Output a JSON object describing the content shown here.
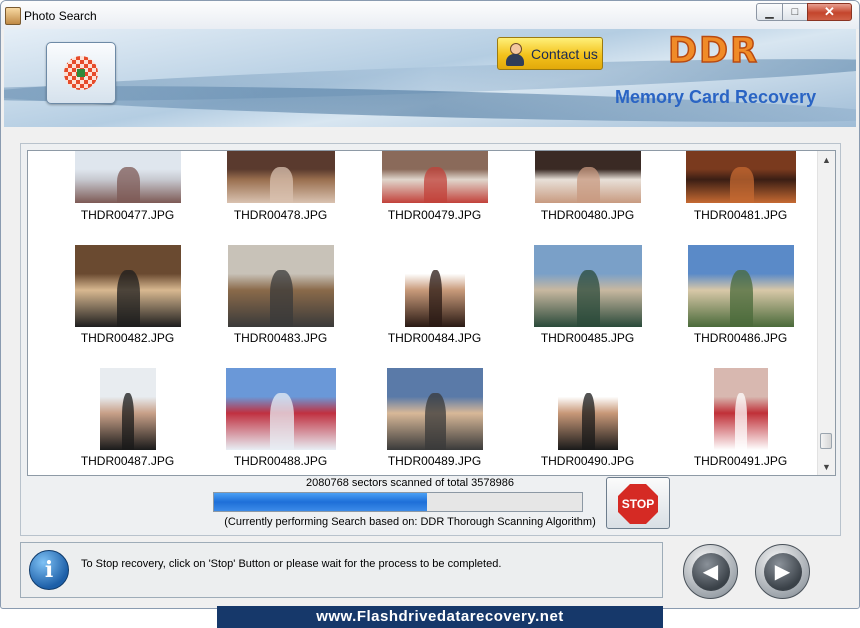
{
  "window": {
    "title": "Photo Search",
    "controls": {
      "minimize": "▁",
      "maximize": "□",
      "close": "✕"
    }
  },
  "header": {
    "contact_label": "Contact us",
    "brand": "DDR",
    "product": "Memory Card Recovery"
  },
  "gallery": {
    "rows": [
      [
        {
          "name": "THDR00477.JPG",
          "colors": [
            "#dfe6ee",
            "#7d5a55",
            "#c7c9d0"
          ]
        },
        {
          "name": "THDR00478.JPG",
          "colors": [
            "#5a3a2e",
            "#d9c2b0",
            "#9a6f4f"
          ]
        },
        {
          "name": "THDR00479.JPG",
          "colors": [
            "#8a6a5a",
            "#c2413a",
            "#e0d6cc"
          ]
        },
        {
          "name": "THDR00480.JPG",
          "colors": [
            "#3a2a24",
            "#c89a80",
            "#e8e0d8"
          ]
        },
        {
          "name": "THDR00481.JPG",
          "colors": [
            "#7a3a1e",
            "#c66a32",
            "#3a1e14"
          ]
        }
      ],
      [
        {
          "name": "THDR00482.JPG",
          "colors": [
            "#6a4a30",
            "#1e1e1e",
            "#d8b890"
          ]
        },
        {
          "name": "THDR00483.JPG",
          "colors": [
            "#c8c2b8",
            "#3a3a3a",
            "#8a6a4a"
          ]
        },
        {
          "name": "THDR00484.JPG",
          "colors": [
            "#ffffff",
            "#2a1a14",
            "#c89a7a"
          ]
        },
        {
          "name": "THDR00485.JPG",
          "colors": [
            "#7aa0c8",
            "#2a4a3a",
            "#c8b8a0"
          ]
        },
        {
          "name": "THDR00486.JPG",
          "colors": [
            "#5a8ac8",
            "#4a6a3a",
            "#d8c8a8"
          ]
        }
      ],
      [
        {
          "name": "THDR00487.JPG",
          "colors": [
            "#e8ecf0",
            "#1a1a1a",
            "#c8a088"
          ]
        },
        {
          "name": "THDR00488.JPG",
          "colors": [
            "#6a98d8",
            "#e8eef4",
            "#c03040"
          ]
        },
        {
          "name": "THDR00489.JPG",
          "colors": [
            "#5a7aa8",
            "#3a3a3a",
            "#d8b898"
          ]
        },
        {
          "name": "THDR00490.JPG",
          "colors": [
            "#ffffff",
            "#1a1a1a",
            "#c89878"
          ]
        },
        {
          "name": "THDR00491.JPG",
          "colors": [
            "#d8b8b0",
            "#ffffff",
            "#c03038"
          ]
        }
      ]
    ]
  },
  "scan": {
    "status": "2080768 sectors scanned of total 3578986",
    "progress": 0.58,
    "algorithm": "(Currently performing Search based on:  DDR Thorough Scanning Algorithm)",
    "stop_label": "STOP"
  },
  "info": {
    "icon": "i",
    "message": "To Stop recovery, click on 'Stop' Button or please wait for the process to be completed."
  },
  "nav": {
    "back": "◀",
    "next": "▶"
  },
  "footer": {
    "website": "www.Flashdrivedatarecovery.net"
  },
  "colors": {
    "accent": "#f08b28",
    "link": "#2a64c4",
    "footer_bg": "#16386a",
    "progress": "#1e6fd8"
  },
  "icons": {
    "app": "app-icon",
    "logo": "software-logo-icon",
    "contact": "person-icon",
    "stop": "stop-sign-icon",
    "info": "info-icon",
    "back": "back-arrow-icon",
    "next": "next-arrow-icon",
    "scroll_up": "scroll-up-icon",
    "scroll_down": "scroll-down-icon"
  }
}
